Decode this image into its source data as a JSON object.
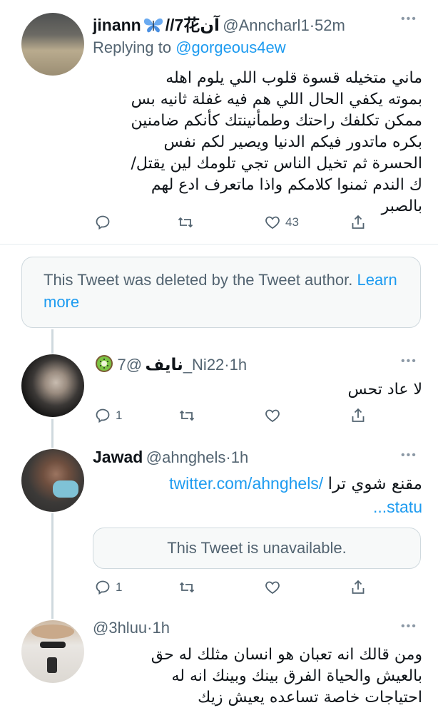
{
  "tweets": {
    "t1": {
      "name": "jinann",
      "name_suffix": "//7花آن",
      "handle": "@Anncharl1",
      "time": "52m",
      "replying_label": "Replying to",
      "replying_to": "@gorgeous4ew",
      "text": "ماني متخيله قسوة قلوب اللي يلوم اهله بموته يكفي الحال اللي هم فيه غفلة ثانيه بس ممكن تكلفك راحتك وطمأنينتك كأنكم ضامنين بكره ماتدور فيكم الدنيا ويصير لكم نفس الحسرة ثم تخيل الناس تجي تلومك لين يقتل/ك الندم ثمنوا كلامكم واذا ماتعرف ادع لهم بالصبر",
      "likes": "43"
    },
    "deleted": {
      "text": "This Tweet was deleted by the Tweet author.",
      "link": "Learn more"
    },
    "t2": {
      "name": "نايف",
      "handle": "@7_Ni22",
      "time": "1h",
      "text": "لا عاد تحس",
      "replies": "1"
    },
    "t3": {
      "name": "Jawad",
      "handle": "@ahnghels",
      "time": "1h",
      "text": "مقنع شوي ترا",
      "link_line1": "twitter.com/ahnghels/",
      "link_line2": "...statu",
      "unavailable": "This Tweet is unavailable.",
      "replies": "1"
    },
    "t4": {
      "handle": "@3hluu",
      "time": "1h",
      "text": "ومن قالك انه تعبان هو انسان مثلك له حق بالعيش والحياة الفرق بينك وبينك انه له احتياجات خاصة تساعده يعيش زيك"
    }
  },
  "dot": "·",
  "more_icon_glyph": "•••",
  "colors": {
    "accent": "#1d9bf0",
    "secondary_text": "#536471",
    "thread_line": "#cfd9de"
  }
}
